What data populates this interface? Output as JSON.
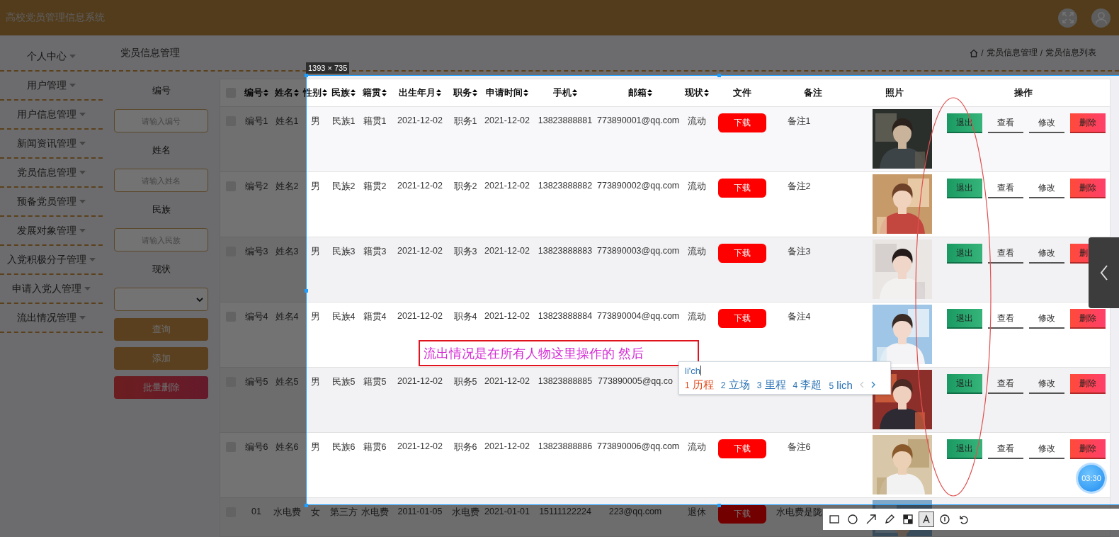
{
  "header": {
    "title": "高校党员管理信息系统"
  },
  "sidebar": {
    "items": [
      {
        "label": "个人中心"
      },
      {
        "label": "用户管理"
      },
      {
        "label": "用户信息管理"
      },
      {
        "label": "新闻资讯管理"
      },
      {
        "label": "党员信息管理"
      },
      {
        "label": "预备党员管理"
      },
      {
        "label": "发展对象管理"
      },
      {
        "label": "入党积极分子管理"
      },
      {
        "label": "申请入党人管理"
      },
      {
        "label": "流出情况管理"
      }
    ]
  },
  "breadcrumb_bar": {
    "title": "党员信息管理",
    "separator": "/",
    "path": [
      "党员信息管理",
      "党员信息列表"
    ]
  },
  "search_panel": {
    "fields": [
      {
        "label": "编号",
        "kind": "input",
        "placeholder": "请输入编号"
      },
      {
        "label": "姓名",
        "kind": "input",
        "placeholder": "请输入姓名"
      },
      {
        "label": "民族",
        "kind": "input",
        "placeholder": "请输入民族"
      },
      {
        "label": "现状",
        "kind": "select"
      }
    ],
    "buttons": [
      {
        "label": "查询",
        "kind": "primary"
      },
      {
        "label": "添加",
        "kind": "primary"
      },
      {
        "label": "批量删除",
        "kind": "danger"
      }
    ]
  },
  "table": {
    "header_checked": false,
    "columns": [
      {
        "label": "编号",
        "sortable": true
      },
      {
        "label": "姓名",
        "sortable": true
      },
      {
        "label": "性别",
        "sortable": true
      },
      {
        "label": "民族",
        "sortable": true
      },
      {
        "label": "籍贯",
        "sortable": true
      },
      {
        "label": "出生年月",
        "sortable": true
      },
      {
        "label": "职务",
        "sortable": true
      },
      {
        "label": "申请时间",
        "sortable": true
      },
      {
        "label": "手机",
        "sortable": true
      },
      {
        "label": "邮箱",
        "sortable": true
      },
      {
        "label": "现状",
        "sortable": true
      },
      {
        "label": "文件",
        "sortable": false
      },
      {
        "label": "备注",
        "sortable": false
      },
      {
        "label": "照片",
        "sortable": false
      },
      {
        "label": "操作",
        "sortable": false
      }
    ],
    "rows": [
      {
        "checked": false,
        "cells": [
          "编号1",
          "姓名1",
          "男",
          "民族1",
          "籍贯1",
          "2021-12-02",
          "职务1",
          "2021-12-02",
          "13823888881",
          "773890001@qq.com",
          "流动"
        ],
        "download": "下载",
        "remark": "备注1",
        "photo": {
          "kind": "picture"
        },
        "actions": [
          {
            "label": "退出",
            "kind": "exit"
          },
          {
            "label": "查看",
            "kind": "view"
          },
          {
            "label": "修改",
            "kind": "edit"
          },
          {
            "label": "删除",
            "kind": "delete"
          }
        ]
      },
      {
        "checked": false,
        "cells": [
          "编号2",
          "姓名2",
          "男",
          "民族2",
          "籍贯2",
          "2021-12-02",
          "职务2",
          "2021-12-02",
          "13823888882",
          "773890002@qq.com",
          "流动"
        ],
        "download": "下载",
        "remark": "备注2",
        "photo": {
          "kind": "picture"
        },
        "actions": [
          {
            "label": "退出",
            "kind": "exit"
          },
          {
            "label": "查看",
            "kind": "view"
          },
          {
            "label": "修改",
            "kind": "edit"
          },
          {
            "label": "删除",
            "kind": "delete"
          }
        ]
      },
      {
        "checked": false,
        "cells": [
          "编号3",
          "姓名3",
          "男",
          "民族3",
          "籍贯3",
          "2021-12-02",
          "职务3",
          "2021-12-02",
          "13823888883",
          "773890003@qq.com",
          "流动"
        ],
        "download": "下载",
        "remark": "备注3",
        "photo": {
          "kind": "picture"
        },
        "actions": [
          {
            "label": "退出",
            "kind": "exit"
          },
          {
            "label": "查看",
            "kind": "view"
          },
          {
            "label": "修改",
            "kind": "edit"
          },
          {
            "label": "删",
            "kind": "delete"
          }
        ]
      },
      {
        "checked": false,
        "cells": [
          "编号4",
          "姓名4",
          "男",
          "民族4",
          "籍贯4",
          "2021-12-02",
          "职务4",
          "2021-12-02",
          "13823888884",
          "773890004@qq.com",
          "流动"
        ],
        "download": "下载",
        "remark": "备注4",
        "photo": {
          "kind": "picture"
        },
        "actions": [
          {
            "label": "退出",
            "kind": "exit"
          },
          {
            "label": "查看",
            "kind": "view"
          },
          {
            "label": "修改",
            "kind": "edit"
          },
          {
            "label": "删除",
            "kind": "delete"
          }
        ]
      },
      {
        "checked": false,
        "cells": [
          "编号5",
          "姓名5",
          "男",
          "民族5",
          "籍贯5",
          "2021-12-02",
          "职务5",
          "2021-12-02",
          "13823888885",
          "773890005@qq.co",
          ""
        ],
        "photo": {
          "kind": "picture"
        },
        "actions": [
          {
            "label": "退出",
            "kind": "exit"
          },
          {
            "label": "查看",
            "kind": "view"
          },
          {
            "label": "修改",
            "kind": "edit"
          },
          {
            "label": "删除",
            "kind": "delete"
          }
        ]
      },
      {
        "checked": false,
        "cells": [
          "编号6",
          "姓名6",
          "男",
          "民族6",
          "籍贯6",
          "2021-12-02",
          "职务6",
          "2021-12-02",
          "13823888886",
          "773890006@qq.com",
          "流动"
        ],
        "download": "下载",
        "remark": "备注6",
        "photo": {
          "kind": "picture"
        },
        "actions": [
          {
            "label": "退出",
            "kind": "exit"
          },
          {
            "label": "查看",
            "kind": "view"
          },
          {
            "label": "修改",
            "kind": "edit"
          },
          {
            "label": "删除",
            "kind": "delete"
          }
        ]
      },
      {
        "checked": false,
        "cells": [
          "01",
          "水电费",
          "女",
          "第三方",
          "水电费",
          "2011-01-05",
          "水电费",
          "2021-01-01",
          "15111122224",
          "223@qq.com",
          "退休"
        ],
        "download": "下载",
        "remark": "水电费是陇",
        "photo": {
          "kind": "picture"
        }
      }
    ]
  },
  "capture": {
    "size_label": "1393 × 735",
    "annotation": "流出情况是在所有人物这里操作的 然后",
    "ime": {
      "input": "li'ch",
      "candidates": [
        {
          "index": "1",
          "text": "历程",
          "selected": true
        },
        {
          "index": "2",
          "text": "立场",
          "selected": false
        },
        {
          "index": "3",
          "text": "里程",
          "selected": false
        },
        {
          "index": "4",
          "text": "李超",
          "selected": false
        },
        {
          "index": "5",
          "text": "lich",
          "selected": false
        }
      ]
    },
    "timer": "03:30",
    "tools": [
      {
        "kind": "rect",
        "selected": false
      },
      {
        "kind": "ellipse",
        "selected": false
      },
      {
        "kind": "arrow",
        "selected": false
      },
      {
        "kind": "pen",
        "selected": false
      },
      {
        "kind": "mosaic",
        "selected": false
      },
      {
        "kind": "text",
        "selected": true
      },
      {
        "kind": "number",
        "selected": false
      },
      {
        "kind": "undo",
        "selected": false
      }
    ]
  }
}
